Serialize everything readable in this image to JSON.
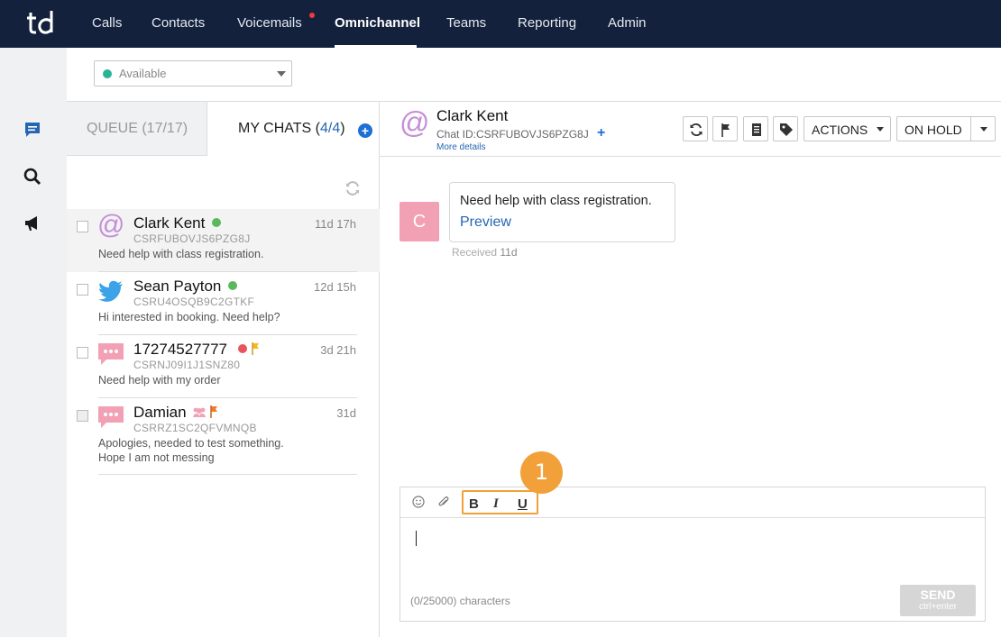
{
  "nav": {
    "items": [
      {
        "label": "Calls"
      },
      {
        "label": "Contacts"
      },
      {
        "label": "Voicemails"
      },
      {
        "label": "Omnichannel"
      },
      {
        "label": "Teams"
      },
      {
        "label": "Reporting"
      },
      {
        "label": "Admin"
      }
    ],
    "active": "Omnichannel",
    "logo_icon": "td-logo",
    "notification_color": "#ef3b3b"
  },
  "rail": {
    "icons": [
      "chat-icon",
      "search-icon",
      "megaphone-icon"
    ],
    "active_color": "#2566b3"
  },
  "status": {
    "value": "Available",
    "dot_color": "#2bb39a"
  },
  "tabs": {
    "queue": "QUEUE (17/17)",
    "mine_prefix": "MY CHATS (",
    "mine_count": "4/4",
    "mine_suffix": ")"
  },
  "chats": [
    {
      "name": "Clark Kent",
      "id": "CSRFUBOVJS6PZG8J",
      "message": "Need help with class registration.",
      "time": "11d 17h",
      "channel": "email-at-icon",
      "status_color": "#5cb85c",
      "selected": true
    },
    {
      "name": "Sean Payton",
      "id": "CSRU4OSQB9C2GTKF",
      "message": "Hi interested in booking. Need help?",
      "time": "12d 15h",
      "channel": "twitter-icon",
      "status_color": "#5cb85c"
    },
    {
      "name": "17274527777",
      "id": "CSRNJ09I1J1SNZ80",
      "message": "Need help with my order",
      "time": "3d 21h",
      "channel": "sms-icon",
      "status_color": "#e8555a",
      "flag_color": "#f2b820"
    },
    {
      "name": "Damian",
      "id": "CSRRZ1SC2QFVMNQB",
      "message": "Apologies, needed to test something. Hope I am not messing",
      "time": "31d",
      "channel": "sms-icon",
      "flag_color": "#f07b2a"
    }
  ],
  "conversation": {
    "name": "Clark Kent",
    "chat_id_label": "Chat ID:",
    "chat_id": "CSRFUBOVJS6PZG8J",
    "more_details": "More details",
    "actions_label": "ACTIONS",
    "hold_label": "ON HOLD",
    "avatar_letter": "C",
    "message": "Need help with class registration.",
    "preview_label": "Preview",
    "received_label": "Received",
    "received_time": "11d"
  },
  "composer": {
    "bold": "B",
    "italic": "I",
    "underline": "U",
    "char_count": "(0/25000) characters",
    "send_label": "SEND",
    "send_hint": "ctrl+enter"
  },
  "step_badge": "1",
  "colors": {
    "nav_bg": "#13213d",
    "accent": "#2566b3",
    "highlight": "#f2a13a"
  }
}
